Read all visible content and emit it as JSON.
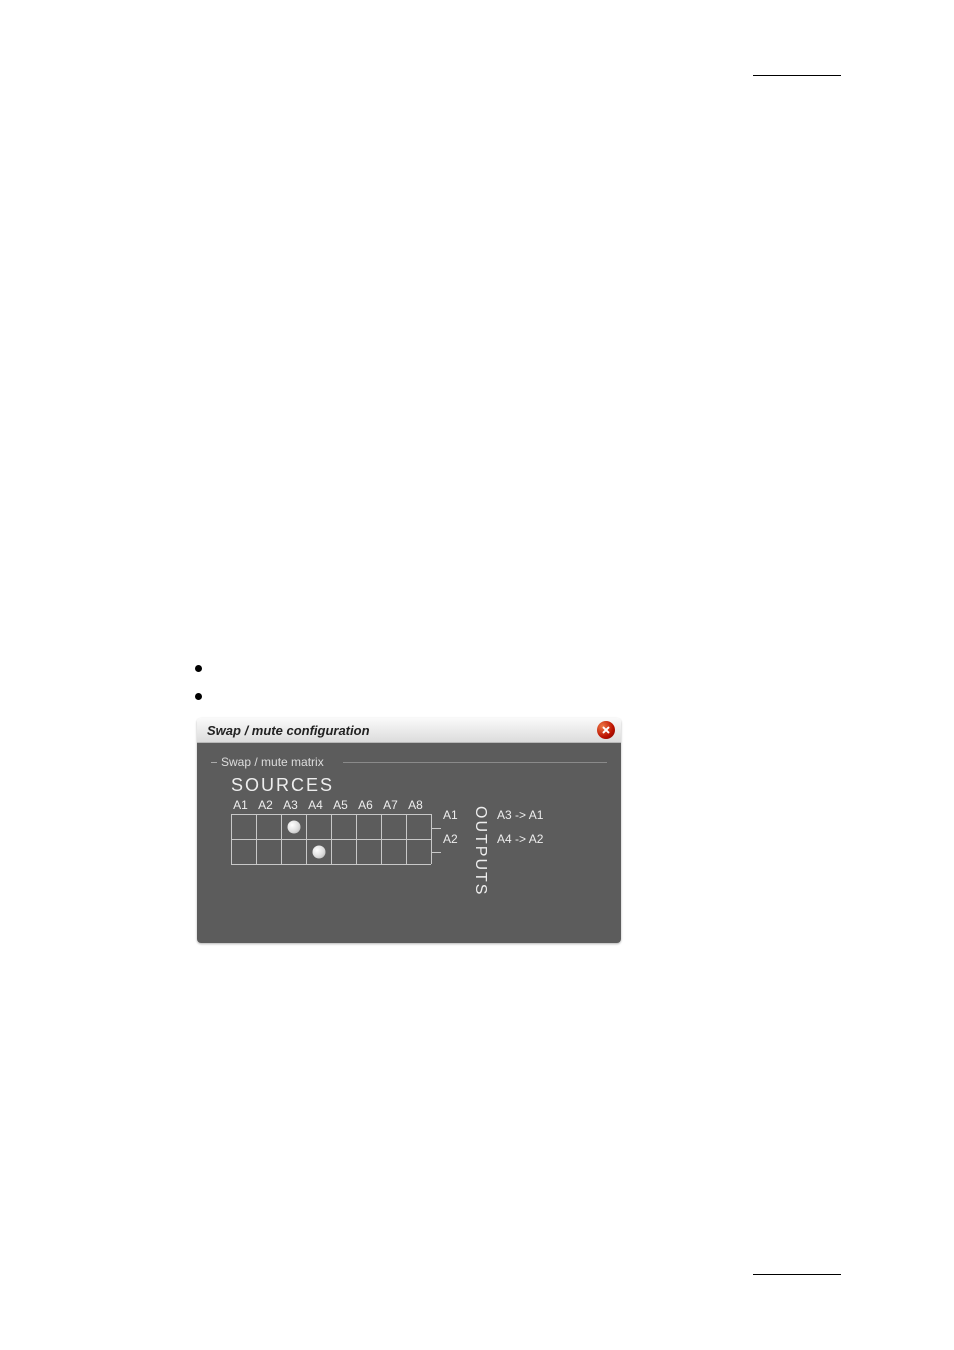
{
  "panel": {
    "title": "Swap / mute configuration",
    "fieldset_label": "Swap / mute matrix",
    "sources_label": "SOURCES",
    "outputs_label": "OUTPUTS",
    "columns": [
      "A1",
      "A2",
      "A3",
      "A4",
      "A5",
      "A6",
      "A7",
      "A8"
    ],
    "rows": [
      "A1",
      "A2"
    ],
    "mappings": [
      "A3  -> A1",
      "A4  -> A2"
    ],
    "nodes": [
      {
        "row": 0,
        "col": 2
      },
      {
        "row": 1,
        "col": 3
      }
    ]
  }
}
